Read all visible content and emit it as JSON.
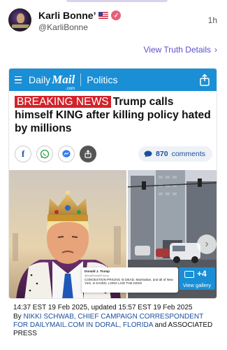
{
  "post": {
    "author_name": "Karli Bonne’",
    "handle": "@KarliBonne",
    "time_ago": "1h",
    "view_link": "View Truth Details"
  },
  "article": {
    "brand_daily": "Daily",
    "brand_mail": "Mail",
    "brand_com": ".com",
    "section": "Politics",
    "breaking_label": "BREAKING NEWS",
    "headline": "Trump calls himself KING after killing policy hated by millions",
    "comments_count": "870",
    "comments_label": "comments",
    "gallery_count": "+4",
    "gallery_label": "View gallery",
    "embedded_post": {
      "name": "Donald J. Trump",
      "handle": "@realDonaldTrump",
      "text": "CONGESTION PRICING IS DEAD. Manhattan, and all of New York, is SAVED. LONG LIVE THE KING!"
    },
    "timestamp": "14:37 EST 19 Feb 2025, updated 15:57 EST 19 Feb 2025",
    "byline_prefix": "By",
    "byline_authors": "NIKKI SCHWAB, CHIEF CAMPAIGN CORRESPONDENT FOR DAILYMAIL.COM IN DORAL, FLORIDA",
    "byline_suffix": "and ASSOCIATED PRESS"
  },
  "icons": [
    "menu-icon",
    "share-icon",
    "facebook-icon",
    "whatsapp-icon",
    "messenger-icon",
    "upload-icon",
    "comment-bubble-icon",
    "gallery-camera-icon",
    "chevron-right-icon"
  ],
  "colors": {
    "dailymail_blue": "#1a8fd6",
    "breaking_red": "#d1232a",
    "link_purple": "#5b4fc7",
    "byline_blue": "#1a4f9c"
  }
}
